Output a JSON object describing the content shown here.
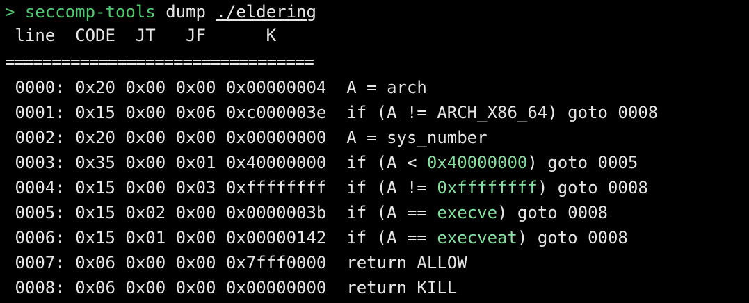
{
  "colors": {
    "background": "#000000",
    "text": "#e6e6e6",
    "prompt": "#4ec96e",
    "highlight": "#86e09e"
  },
  "prompt": {
    "symbol": ">",
    "command": "seccomp-tools",
    "subcommand": "dump",
    "path": "./eldering"
  },
  "header": " line  CODE  JT   JF      K",
  "separator": "=================================",
  "rows": [
    {
      "prefix": " 0000: 0x20 0x00 0x00 0x00000004  A = arch",
      "hl": "",
      "suffix": ""
    },
    {
      "prefix": " 0001: 0x15 0x00 0x06 0xc000003e  if (A != ARCH_X86_64) goto 0008",
      "hl": "",
      "suffix": ""
    },
    {
      "prefix": " 0002: 0x20 0x00 0x00 0x00000000  A = sys_number",
      "hl": "",
      "suffix": ""
    },
    {
      "prefix": " 0003: 0x35 0x00 0x01 0x40000000  if (A < ",
      "hl": "0x40000000",
      "suffix": ") goto 0005"
    },
    {
      "prefix": " 0004: 0x15 0x00 0x03 0xffffffff  if (A != ",
      "hl": "0xffffffff",
      "suffix": ") goto 0008"
    },
    {
      "prefix": " 0005: 0x15 0x02 0x00 0x0000003b  if (A == ",
      "hl": "execve",
      "suffix": ") goto 0008"
    },
    {
      "prefix": " 0006: 0x15 0x01 0x00 0x00000142  if (A == ",
      "hl": "execveat",
      "suffix": ") goto 0008"
    },
    {
      "prefix": " 0007: 0x06 0x00 0x00 0x7fff0000  return ALLOW",
      "hl": "",
      "suffix": ""
    },
    {
      "prefix": " 0008: 0x06 0x00 0x00 0x00000000  return KILL",
      "hl": "",
      "suffix": ""
    }
  ]
}
